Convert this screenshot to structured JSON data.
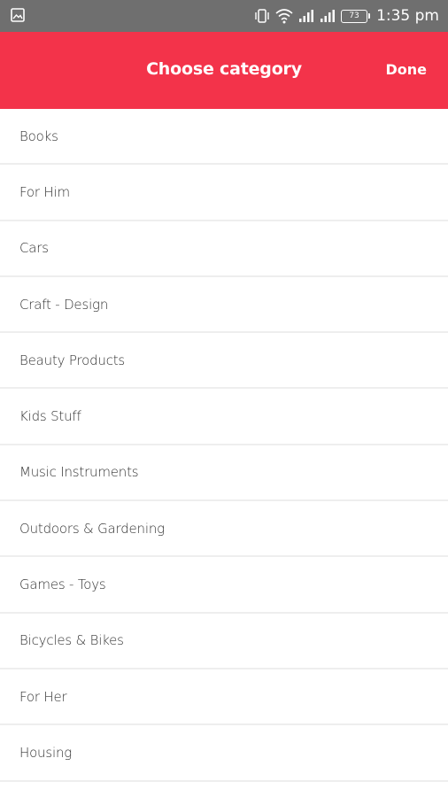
{
  "status_bar": {
    "time": "1:35 pm",
    "battery": "73",
    "icons": [
      "gallery-icon",
      "vibrate-icon",
      "wifi-icon",
      "signal-icon",
      "signal-icon",
      "battery-icon"
    ]
  },
  "app_bar": {
    "title": "Choose category",
    "done_label": "Done",
    "background_color": "#f3334a"
  },
  "categories": [
    "Books",
    "For Him",
    "Cars",
    "Craft - Design",
    "Beauty Products",
    "Kids Stuff",
    "Music Instruments",
    "Outdoors & Gardening",
    "Games - Toys",
    "Bicycles & Bikes",
    "For Her",
    "Housing"
  ]
}
